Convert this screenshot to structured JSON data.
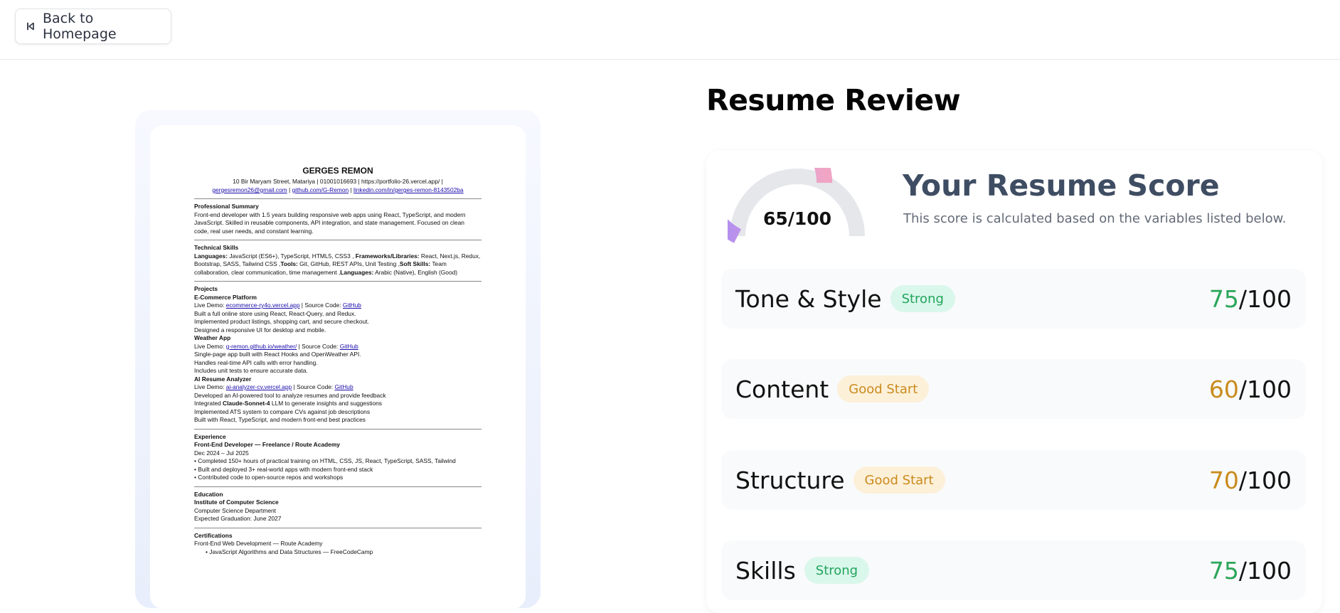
{
  "nav": {
    "back_label": "Back to Homepage"
  },
  "resume": {
    "name": "GERGES REMON",
    "contact_line1": "10 Bir Maryam Street, Matariya | 01001016693 | https://portfolio-26.vercel.app/ |",
    "email": "gergesremon26@gmail.com",
    "github": "github.com/G-Remon",
    "linkedin": "linkedin.com/in/gerges-remon-8143502ba",
    "summary_heading": "Professional Summary",
    "summary_lines": [
      "Front-end developer with 1.5 years building responsive web apps using React, TypeScript, and modern",
      "JavaScript. Skilled in reusable components, API integration, and state management. Focused on clean",
      "code, real user needs, and constant learning."
    ],
    "skills_heading": "Technical Skills",
    "skills_lines": [
      {
        "b1": "Languages:",
        "t1": " JavaScript (ES6+), TypeScript, HTML5, CSS3 , ",
        "b2": "Frameworks/Libraries:",
        "t2": " React, Next.js, Redux,"
      },
      {
        "b1": "",
        "t1": "Bootstrap, SASS, Tailwind CSS ,",
        "b2": "Tools:",
        "t2": " Git, GitHub, REST APIs, Unit Testing ,",
        "b3": "Soft Skills:",
        "t3": " Team"
      },
      {
        "b1": "",
        "t1": "collaboration, clear communication, time management ,",
        "b2": "Languages:",
        "t2": " Arabic (Native), English (Good)"
      }
    ],
    "projects_heading": "Projects",
    "projects": [
      {
        "title": "E-Commerce Platform",
        "demo_prefix": "Live Demo: ",
        "demo_link": "ecommerce-ry4o.vercel.app",
        "source_prefix": " | Source Code: ",
        "source_link": "GitHub",
        "lines": [
          "Built a full online store using React, React-Query, and Redux.",
          "Implemented product listings, shopping cart, and secure checkout.",
          "Designed a responsive UI for desktop and mobile."
        ]
      },
      {
        "title": "Weather App",
        "demo_prefix": "Live Demo: ",
        "demo_link": "g-remon.github.io/weather/",
        "source_prefix": " | Source Code: ",
        "source_link": "GitHub",
        "lines": [
          "Single-page app built with React Hooks and OpenWeather API.",
          "Handles real-time API calls with error handling.",
          "Includes unit tests to ensure accurate data."
        ]
      },
      {
        "title": "AI Resume Analyzer",
        "demo_prefix": "Live Demo: ",
        "demo_link": "ai-analyzer-cv.vercel.app",
        "source_prefix": " | Source Code: ",
        "source_link": "GitHub",
        "lines": [
          "Developed an AI-powered tool to analyze resumes and provide feedback"
        ],
        "line_rich": {
          "pre": "Integrated ",
          "bold": "Claude-Sonnet-4",
          "post": " LLM to generate insights and suggestions"
        },
        "lines_after": [
          "Implemented ATS system to compare CVs against job descriptions",
          "Built with React, TypeScript, and modern front-end best practices"
        ]
      }
    ],
    "experience_heading": "Experience",
    "experience_title": "Front-End Developer — Freelance / Route Academy",
    "experience_dates": "Dec 2024 – Jul 2025",
    "experience_lines": [
      "• Completed 150+ hours of practical training on HTML, CSS, JS, React, TypeScript, SASS, Tailwind",
      "• Built and deployed 3+ real-world apps with modern front-end stack",
      "• Contributed code to open-source repos and workshops"
    ],
    "education_heading": "Education",
    "education_school": "Institute of Computer Science",
    "education_lines": [
      "Computer Science Department",
      "Expected Graduation: June 2027"
    ],
    "cert_heading": "Certifications",
    "cert_line": "Front-End Web Development — Route Academy",
    "cert_bullet": "•        JavaScript Algorithms and Data Structures — FreeCodeCamp"
  },
  "review": {
    "title": "Resume Review",
    "score_label": "65/100",
    "score_value": 65,
    "score_max": 100,
    "score_title": "Your Resume Score",
    "score_subtitle": "This score is calculated based on the variables listed below.",
    "categories": [
      {
        "name": "Tone & Style",
        "badge": "Strong",
        "score": "75",
        "max": "/100"
      },
      {
        "name": "Content",
        "badge": "Good Start",
        "score": "60",
        "max": "/100"
      },
      {
        "name": "Structure",
        "badge": "Good Start",
        "score": "70",
        "max": "/100"
      },
      {
        "name": "Skills",
        "badge": "Strong",
        "score": "75",
        "max": "/100"
      }
    ]
  },
  "colors": {
    "strong_text": "#22a55c",
    "strong_bg": "#daf7ec",
    "good_text": "#c98b1d",
    "good_bg": "#fdf0d9",
    "gauge_start": "#a78bfa",
    "gauge_end": "#f0a5c5",
    "gauge_track": "#e5e7eb"
  }
}
